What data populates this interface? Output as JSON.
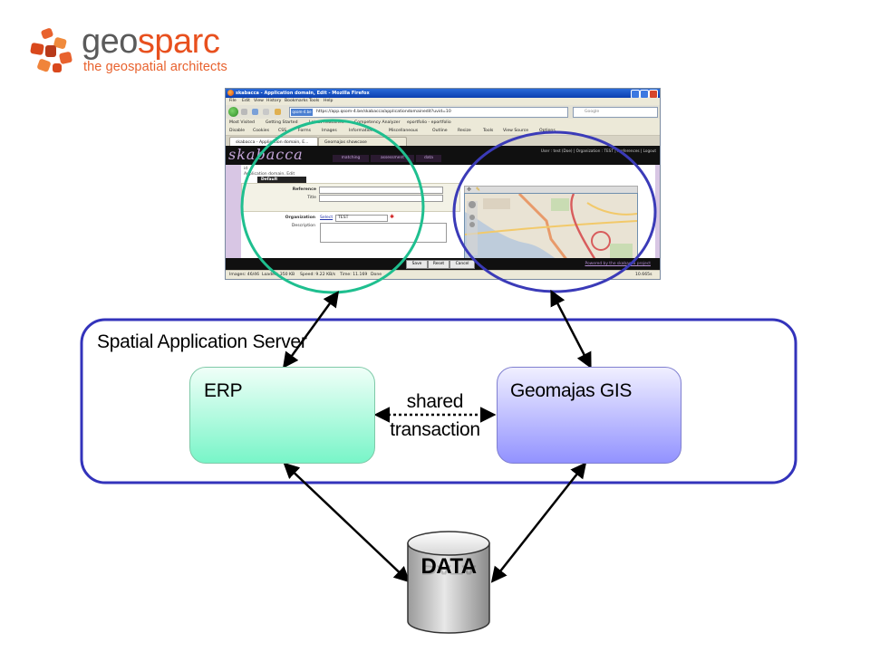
{
  "logo": {
    "word_part1": "geo",
    "word_part2": "sparc",
    "tagline": "the geospatial architects",
    "accent_color": "#e8501e",
    "gray_color": "#5a5a5a"
  },
  "browser": {
    "title": "skabacca - Application domain, Edit - Mozilla Firefox",
    "menu": [
      "File",
      "Edit",
      "View",
      "History",
      "Bookmarks",
      "Tools",
      "Help"
    ],
    "url": "https://app.qsom-4.be/skabacca/applicationdomainedit?uvid=10",
    "url_identity": "qsom-4.be",
    "search_placeholder": "Google",
    "bookmarks": [
      "Most Visited",
      "Getting Started",
      "Latest Headlines",
      "Competency Analyzer",
      "eportfolio - eportfolio"
    ],
    "devbar": [
      "Disable",
      "Cookies",
      "CSS",
      "Forms",
      "Images",
      "Information",
      "Miscellaneous",
      "Outline",
      "Resize",
      "Tools",
      "View Source",
      "Options"
    ],
    "tabs": [
      "skabacca - Application domain, E...",
      "Geomajas showcase"
    ],
    "status": [
      "Images: 46/46",
      "Loaded: 350 KB",
      "Speed: 9.22 KB/s",
      "Time: 11.169",
      "Done"
    ],
    "status_right": "10.665s",
    "app": {
      "logo": "skabacca",
      "menu": [
        "matching",
        "assessment",
        "data"
      ],
      "user": "User : test (Doe) | Organization : TEST | Preferences | Logout",
      "crumb_id": "id",
      "crumb_title": "Application domain, Edit",
      "tab_default": "Default",
      "label_reference": "Reference",
      "label_title": "Title",
      "label_organization": "Organization",
      "select_link": "Select",
      "org_value": "TEST",
      "label_description": "Description",
      "btn_save": "Save",
      "btn_reset": "Reset",
      "btn_cancel": "Cancel",
      "powered": "Powered by the skabacca project",
      "map_scale": "1:5,000 m",
      "map_powered": "powered by geomajas"
    }
  },
  "diagram": {
    "server_title": "Spatial Application Server",
    "erp_label": "ERP",
    "gis_label": "Geomajas GIS",
    "link_line1": "shared",
    "link_line2": "transaction",
    "data_label": "DATA",
    "erp_color": "#78f5c8",
    "gis_color": "#9292ff",
    "server_border_color": "#3333bb",
    "erp_highlight_color": "#1fbf8f",
    "gis_highlight_color": "#3b3bb8"
  }
}
